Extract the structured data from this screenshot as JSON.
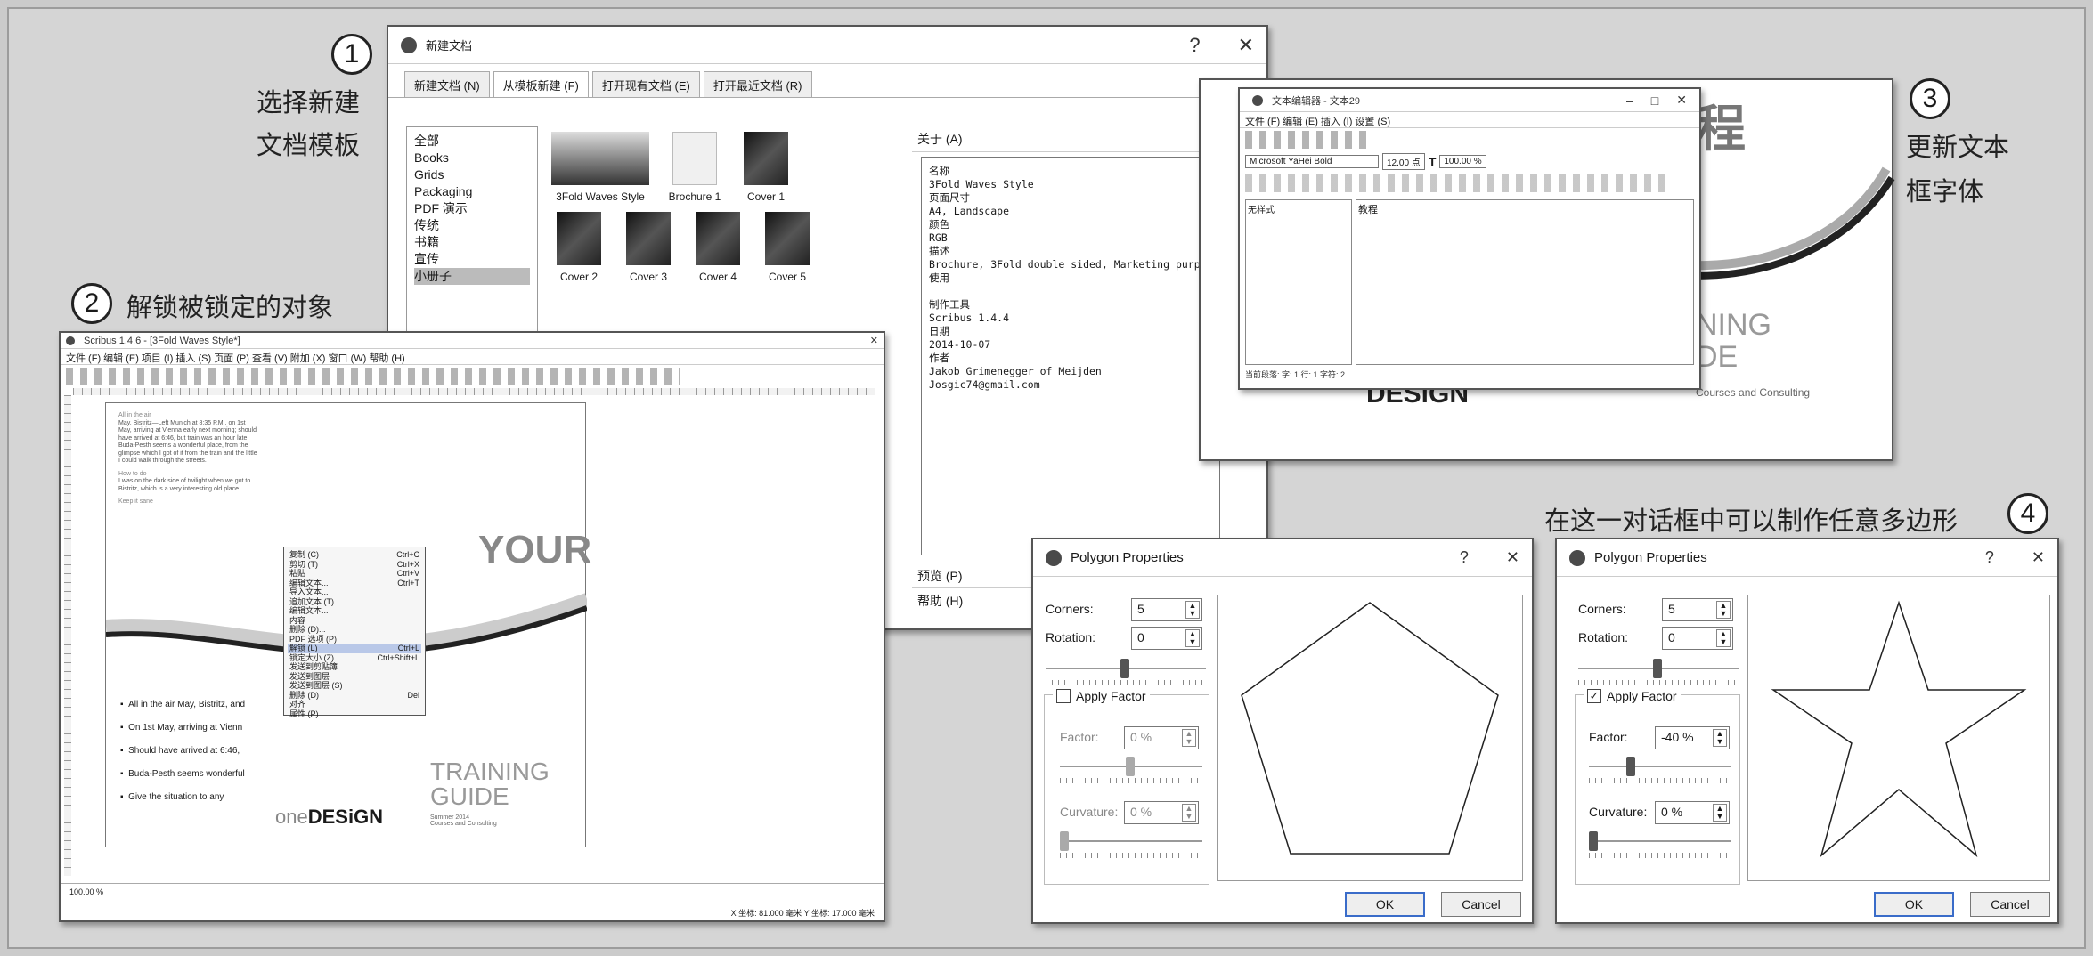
{
  "steps": {
    "s1": {
      "num": "1",
      "cap1": "选择新建",
      "cap2": "文档模板"
    },
    "s2": {
      "num": "2",
      "cap": "解锁被锁定的对象"
    },
    "s3": {
      "num": "3",
      "cap1": "更新文本",
      "cap2": "框字体"
    },
    "s4": {
      "num": "4",
      "cap": "在这一对话框中可以制作任意多边形"
    }
  },
  "new_doc": {
    "title": "新建文档",
    "help": "?",
    "close": "✕",
    "tabs": [
      "新建文档 (N)",
      "从模板新建 (F)",
      "打开现有文档 (E)",
      "打开最近文档 (R)"
    ],
    "categories": [
      "全部",
      "Books",
      "Grids",
      "Packaging",
      "PDF 演示",
      "传统",
      "书籍",
      "宣传",
      "小册子"
    ],
    "templates": [
      "3Fold Waves Style",
      "Brochure 1",
      "Cover 1",
      "Cover 2",
      "Cover 3",
      "Cover 4",
      "Cover 5"
    ],
    "about_header": "关于 (A)",
    "about_text": "名称\n3Fold Waves Style\n页面尺寸\nA4, Landscape\n颜色\nRGB\n描述\nBrochure, 3Fold double sided, Marketing purpose\n使用\n\n制作工具\nScribus 1.4.4\n日期\n2014-10-07\n作者\nJakob Grimenegger of Meijden\nJosgic74@gmail.com",
    "preview": "预览 (P)",
    "help_section": "帮助 (H)"
  },
  "scribus": {
    "title": "Scribus 1.4.6 - [3Fold Waves Style*]",
    "menu": "文件 (F)  编辑 (E)  项目 (I)  插入 (S)  页面 (P)  查看 (V)  附加 (X)  窗口 (W)  帮助 (H)",
    "text_lines": [
      "All in the air",
      "May, Bistritz—Left Munich at 8:35 P.M., on 1st",
      "May, arriving at Vienna early next morning; should",
      "have arrived at 6:46, but train was an hour late.",
      "Buda-Pesth seems a wonderful place, from the",
      "glimpse which I got of it from the train and the little",
      "I could walk through the streets.",
      "How to do",
      "I was on the dark side of twilight when we got to",
      "Bistritz, which is a very interesting old place.",
      "Keep it sane"
    ],
    "big_word": "YOUR",
    "training1": "TRAINING",
    "training2": "GUIDE",
    "small_info": "Summer 2014\nCourses and Consulting",
    "bullets": [
      "All in the air May, Bistritz, and",
      "On 1st May, arriving at Vienn",
      "Should have arrived at 6:46,",
      "Buda-Pesth seems wonderful",
      "Give the situation to any"
    ],
    "logo_one": "one",
    "logo_design": "DESiGN",
    "context_menu": [
      [
        "复制 (C)",
        "Ctrl+C"
      ],
      [
        "剪切 (T)",
        "Ctrl+X"
      ],
      [
        "粘贴",
        "Ctrl+V"
      ],
      [
        "编辑文本...",
        "Ctrl+T"
      ],
      [
        "导入文本...",
        ""
      ],
      [
        "追加文本 (T)...",
        ""
      ],
      [
        "编辑文本...",
        ""
      ],
      [
        "内容",
        ""
      ],
      [
        "删除 (D)...",
        ""
      ],
      [
        "PDF 选项 (P)",
        ""
      ],
      [
        "解锁 (L)",
        "Ctrl+L"
      ],
      [
        "锁定大小 (Z)",
        "Ctrl+Shift+L"
      ],
      [
        "发送到剪贴簿",
        ""
      ],
      [
        "发送到图层",
        ""
      ],
      [
        "发送到图层 (S)",
        ""
      ],
      [
        "删除 (D)",
        "Del"
      ],
      [
        "对齐",
        ""
      ],
      [
        "属性 (P)",
        ""
      ]
    ],
    "statusbar": "100.00 %",
    "coords": "X 坐标: 81.000 毫米     Y 坐标: 17.000 毫米"
  },
  "story_editor": {
    "title": "文本编辑器 - 文本29",
    "menu": "文件 (F)   编辑 (E)   插入 (I)   设置 (S)",
    "font": "Microsoft YaHei Bold",
    "size": "12.00 点",
    "scale1": "100.00 %",
    "style_label": "无样式",
    "body": "教程",
    "status": "当前段落:  字: 1   行: 1   字符: 2",
    "bg_heading": "教程",
    "bg_ning": "NING",
    "bg_de": "DE",
    "bg_design": "DESiGN",
    "bg_consult": "Courses and Consulting"
  },
  "poly1": {
    "title": "Polygon Properties",
    "help": "?",
    "close": "✕",
    "corners_label": "Corners:",
    "corners": "5",
    "rotation_label": "Rotation:",
    "rotation": "0",
    "apply_label": "Apply Factor",
    "apply_checked": false,
    "factor_label": "Factor:",
    "factor": "0 %",
    "curv_label": "Curvature:",
    "curv": "0 %",
    "ok": "OK",
    "cancel": "Cancel"
  },
  "poly2": {
    "title": "Polygon Properties",
    "help": "?",
    "close": "✕",
    "corners_label": "Corners:",
    "corners": "5",
    "rotation_label": "Rotation:",
    "rotation": "0",
    "apply_label": "Apply Factor",
    "apply_checked": true,
    "factor_label": "Factor:",
    "factor": "-40 %",
    "curv_label": "Curvature:",
    "curv": "0 %",
    "ok": "OK",
    "cancel": "Cancel"
  },
  "colors": {
    "frame_bg": "#d5d5d5",
    "accent": "#3a6cc9",
    "wave": "#222222"
  }
}
